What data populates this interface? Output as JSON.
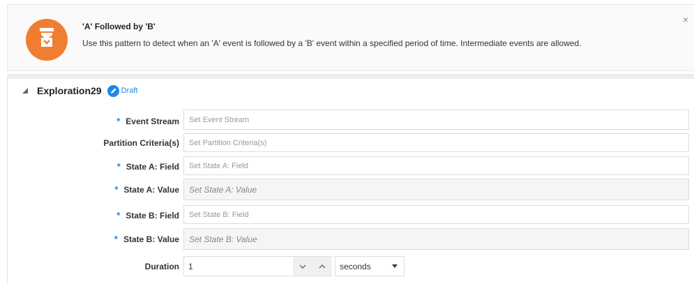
{
  "banner": {
    "icon": "pattern-icon",
    "title": "'A' Followed by 'B'",
    "description": "Use this pattern to detect when an 'A' event is followed by a 'B' event within a specified period of time. Intermediate events are allowed.",
    "close_glyph": "×"
  },
  "section": {
    "title": "Exploration29",
    "status": "Draft"
  },
  "form": {
    "required_marker": "*",
    "event_stream": {
      "label": "Event Stream",
      "placeholder": "Set Event Stream",
      "required": true
    },
    "partition": {
      "label": "Partition Criteria(s)",
      "placeholder": "Set Partition Criteria(s)",
      "required": false
    },
    "state_a_field": {
      "label": "State A: Field",
      "placeholder": "Set State A: Field",
      "required": true
    },
    "state_a_value": {
      "label": "State A: Value",
      "placeholder": "Set State A: Value",
      "required": true
    },
    "state_b_field": {
      "label": "State B: Field",
      "placeholder": "Set State B: Field",
      "required": true
    },
    "state_b_value": {
      "label": "State B: Value",
      "placeholder": "Set State B: Value",
      "required": true
    },
    "duration": {
      "label": "Duration",
      "value": "1",
      "unit": "seconds"
    }
  },
  "colors": {
    "accent": "#1e88e5",
    "banner_icon": "#ef7e33"
  }
}
